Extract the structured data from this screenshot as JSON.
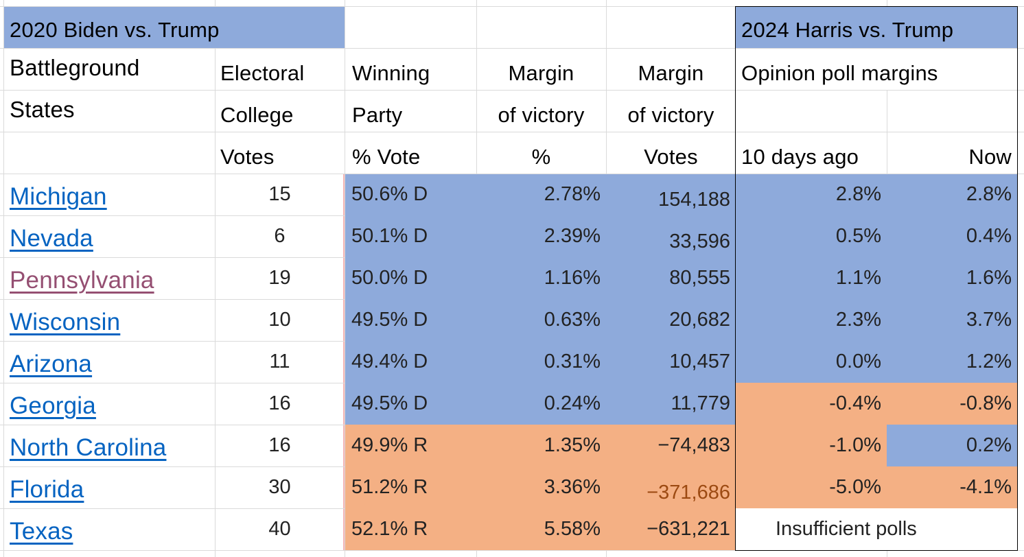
{
  "header": {
    "title_2020": "2020 Biden vs. Trump",
    "title_2024": "2024 Harris vs. Trump",
    "col_state": [
      "Battleground",
      "States"
    ],
    "col_ec": [
      "Electoral",
      "College",
      "Votes"
    ],
    "col_party": [
      "Winning",
      "Party",
      "% Vote"
    ],
    "col_margin_pct": [
      "Margin",
      "of victory",
      "%"
    ],
    "col_margin_votes": [
      "Margin",
      "of victory",
      "Votes"
    ],
    "col_polls": "Opinion poll margins",
    "col_poll_prev": "10 days ago",
    "col_poll_now": "Now"
  },
  "colors": {
    "democrat_blue": "#8eaadb",
    "republican_orange": "#f4b084",
    "link_blue": "#0563c1",
    "link_visited": "#954f72",
    "negative_brown": "#9c4a12"
  },
  "rows": [
    {
      "state": "Michigan",
      "ec": "15",
      "party": "50.6% D",
      "margin_pct": "2.78%",
      "margin_votes": "154,188",
      "poll_prev": "2.8%",
      "poll_now": "2.8%"
    },
    {
      "state": "Nevada",
      "ec": "6",
      "party": "50.1% D",
      "margin_pct": "2.39%",
      "margin_votes": "33,596",
      "poll_prev": "0.5%",
      "poll_now": "0.4%"
    },
    {
      "state": "Pennsylvania",
      "ec": "19",
      "party": "50.0% D",
      "margin_pct": "1.16%",
      "margin_votes": "80,555",
      "poll_prev": "1.1%",
      "poll_now": "1.6%"
    },
    {
      "state": "Wisconsin",
      "ec": "10",
      "party": "49.5% D",
      "margin_pct": "0.63%",
      "margin_votes": "20,682",
      "poll_prev": "2.3%",
      "poll_now": "3.7%"
    },
    {
      "state": "Arizona",
      "ec": "11",
      "party": "49.4% D",
      "margin_pct": "0.31%",
      "margin_votes": "10,457",
      "poll_prev": "0.0%",
      "poll_now": "1.2%"
    },
    {
      "state": "Georgia",
      "ec": "16",
      "party": "49.5% D",
      "margin_pct": "0.24%",
      "margin_votes": "11,779",
      "poll_prev": "-0.4%",
      "poll_now": "-0.8%"
    },
    {
      "state": "North Carolina",
      "ec": "16",
      "party": "49.9% R",
      "margin_pct": "1.35%",
      "margin_votes": "−74,483",
      "poll_prev": "-1.0%",
      "poll_now": "0.2%"
    },
    {
      "state": "Florida",
      "ec": "30",
      "party": "51.2% R",
      "margin_pct": "3.36%",
      "margin_votes": "−371,686",
      "poll_prev": "-5.0%",
      "poll_now": "-4.1%"
    },
    {
      "state": "Texas",
      "ec": "40",
      "party": "52.1% R",
      "margin_pct": "5.58%",
      "margin_votes": "−631,221",
      "poll_note": "Insufficient polls"
    }
  ]
}
